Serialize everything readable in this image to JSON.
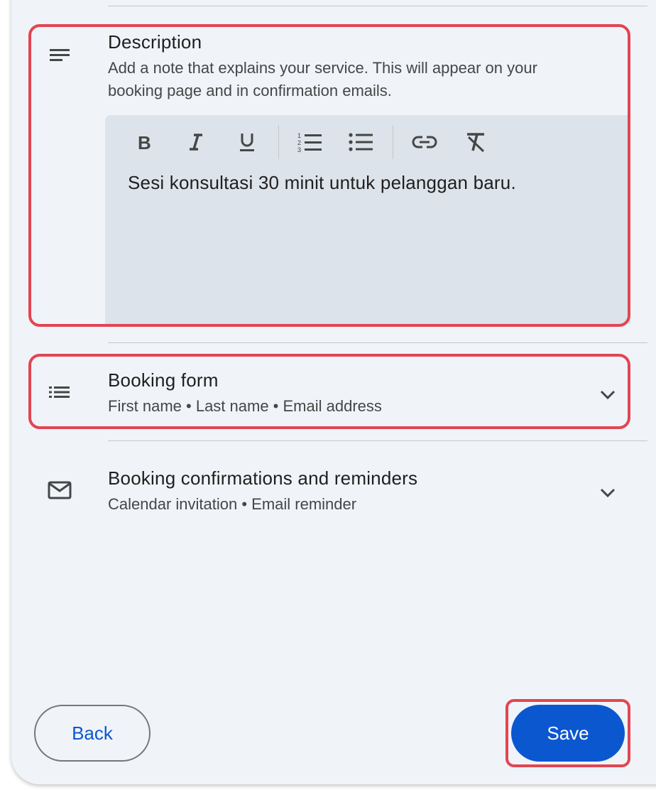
{
  "description": {
    "title": "Description",
    "help_line1": "Add a note that explains your service. This will appear on your",
    "help_line2": "booking page and in confirmation emails.",
    "icon": "notes-icon",
    "editor": {
      "content": "Sesi konsultasi 30 minit untuk pelanggan baru.",
      "toolbar": [
        "bold",
        "italic",
        "underline",
        "numbered-list",
        "bulleted-list",
        "link",
        "clear-formatting"
      ]
    }
  },
  "booking_form": {
    "title": "Booking form",
    "subtitle": "First name • Last name • Email address",
    "icon": "list-icon"
  },
  "confirmations": {
    "title": "Booking confirmations and reminders",
    "subtitle": "Calendar invitation • Email reminder",
    "icon": "mail-icon"
  },
  "footer": {
    "back_label": "Back",
    "save_label": "Save"
  },
  "colors": {
    "accent": "#0b57d0",
    "highlight": "#e24552",
    "panel_bg": "#f0f4f9",
    "editor_bg": "#dde3ea"
  }
}
